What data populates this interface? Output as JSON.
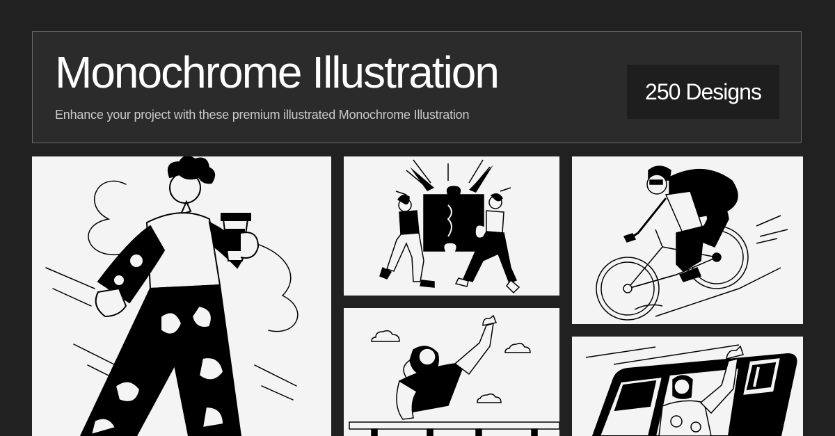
{
  "header": {
    "title": "Monochrome Illustration",
    "subtitle": "Enhance your project with these premium illustrated Monochrome Illustration",
    "badge": "250 Designs"
  },
  "colors": {
    "background": "#212121",
    "banner": "#2b2b2b",
    "badge": "#1e1e1e",
    "card": "#f4f4f4",
    "ink": "#000000"
  },
  "gallery": [
    {
      "icon": "walking-man-with-coffee-illustration"
    },
    {
      "icon": "two-people-joining-puzzle-illustration"
    },
    {
      "icon": "cyclist-illustration"
    },
    {
      "icon": "woman-waving-at-railing-illustration"
    },
    {
      "icon": "woman-waving-from-train-illustration"
    }
  ]
}
